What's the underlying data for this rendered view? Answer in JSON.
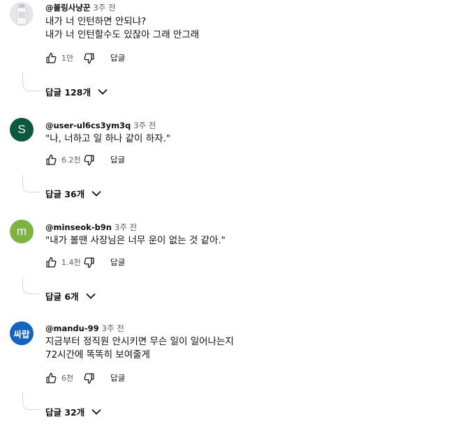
{
  "comments": [
    {
      "author": "@볼링사냥꾼",
      "time": "3주 전",
      "lines": [
        "내가 너 인턴하면 안되냐?",
        "내가 너 인턴할수도 있잖아 그래 안그래"
      ],
      "likes": "1만",
      "reply_label": "답글",
      "replies_label": "답글 128개",
      "avatar": {
        "type": "image",
        "bg": "#e9e9e9"
      }
    },
    {
      "author": "@user-ul6cs3ym3q",
      "time": "3주 전",
      "lines": [
        "\"나, 너하고 일 하나 같이 하자.\""
      ],
      "likes": "6.2천",
      "reply_label": "답글",
      "replies_label": "답글 36개",
      "avatar": {
        "type": "letter",
        "letter": "S",
        "bg": "#0b5a3e"
      }
    },
    {
      "author": "@minseok-b9n",
      "time": "3주 전",
      "lines": [
        "\"내가 볼땐 사장님은 너무 운이 없는 것 같아.\""
      ],
      "likes": "1.4천",
      "reply_label": "답글",
      "replies_label": "답글 6개",
      "avatar": {
        "type": "letter",
        "letter": "m",
        "bg": "#7cb342"
      }
    },
    {
      "author": "@mandu-99",
      "time": "3주 전",
      "lines": [
        "지금부터 정직원 안시키면 무슨 일이 일어나는지",
        "72시간에 똑똑히 보여줄게"
      ],
      "likes": "6천",
      "reply_label": "답글",
      "replies_label": "답글 32개",
      "avatar": {
        "type": "text",
        "letter": "싸랍",
        "bg": "#1565c0"
      }
    }
  ],
  "icons": {
    "like": "thumbs-up-icon",
    "dislike": "thumbs-down-icon",
    "expand": "chevron-down-icon"
  }
}
